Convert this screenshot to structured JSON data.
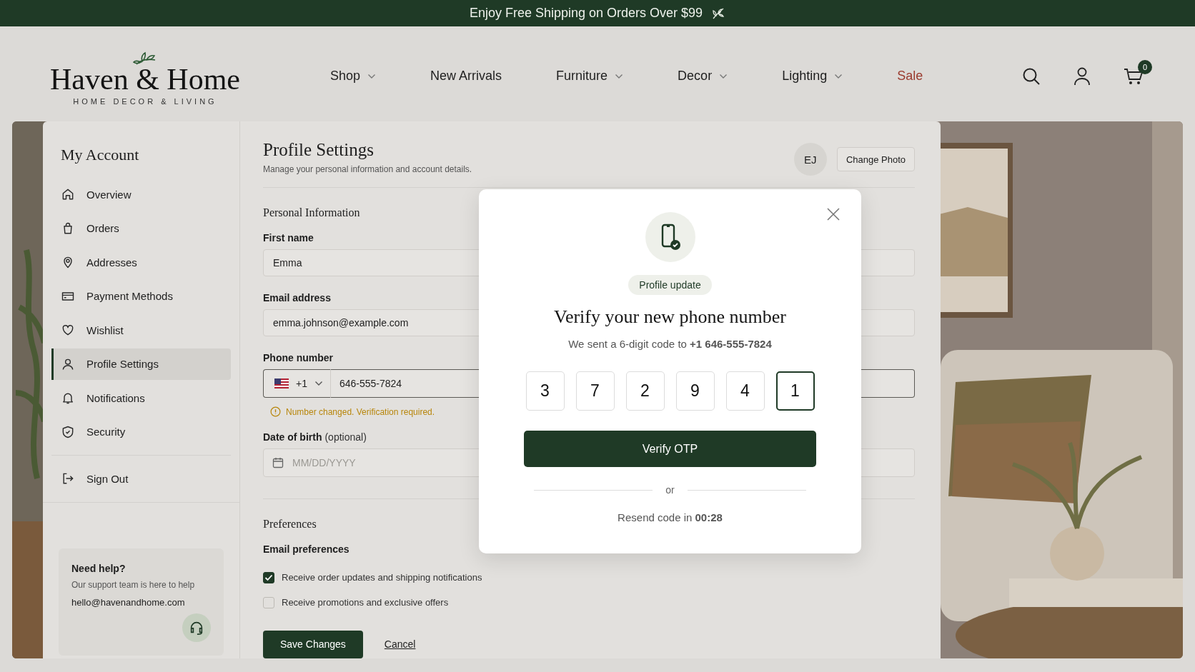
{
  "banner": {
    "text": "Enjoy Free Shipping on Orders Over $99"
  },
  "header": {
    "logo": {
      "name": "Haven & Home",
      "tagline": "HOME DECOR & LIVING"
    },
    "nav": [
      {
        "label": "Shop",
        "has_menu": true,
        "kind": "link"
      },
      {
        "label": "New Arrivals",
        "has_menu": false,
        "kind": "link"
      },
      {
        "label": "Furniture",
        "has_menu": true,
        "kind": "link"
      },
      {
        "label": "Decor",
        "has_menu": true,
        "kind": "link"
      },
      {
        "label": "Lighting",
        "has_menu": true,
        "kind": "link"
      },
      {
        "label": "Sale",
        "has_menu": false,
        "kind": "sale"
      }
    ],
    "cart_count": "0"
  },
  "sidebar": {
    "title": "My Account",
    "items": [
      {
        "label": "Overview",
        "selected": false
      },
      {
        "label": "Orders",
        "selected": false
      },
      {
        "label": "Addresses",
        "selected": false
      },
      {
        "label": "Payment Methods",
        "selected": false
      },
      {
        "label": "Wishlist",
        "selected": false
      },
      {
        "label": "Profile Settings",
        "selected": true
      },
      {
        "label": "Notifications",
        "selected": false
      },
      {
        "label": "Security",
        "selected": false
      }
    ],
    "sign_out": "Sign Out",
    "help": {
      "title": "Need help?",
      "text": "Our support team is here to help",
      "email": "hello@havenandhome.com"
    }
  },
  "profile": {
    "title": "Profile Settings",
    "subtitle": "Manage your personal information and account details.",
    "avatar": "EJ",
    "change_photo": "Change Photo",
    "personal_title": "Personal Information",
    "first_name": {
      "label": "First name",
      "value": "Emma"
    },
    "email": {
      "label": "Email address",
      "value": "emma.johnson@example.com"
    },
    "phone": {
      "label": "Phone number",
      "country_code": "+1",
      "value": "646-555-7824",
      "warning": "Number changed. Verification required."
    },
    "birth": {
      "label": "Date of birth",
      "hint": "(optional)",
      "placeholder": "MM/DD/YYYY"
    },
    "preferences_title": "Preferences",
    "email_prefs_title": "Email preferences",
    "checkboxes": [
      {
        "label": "Receive order updates and shipping notifications",
        "checked": true
      },
      {
        "label": "Receive promotions and exclusive offers",
        "checked": false
      }
    ],
    "save": "Save Changes",
    "cancel": "Cancel"
  },
  "modal": {
    "badge": "Profile update",
    "title": "Verify your new phone number",
    "text": "We sent a 6-digit code to **+1 646-555-7824**",
    "digits": [
      {
        "value": "3",
        "focused": false
      },
      {
        "value": "7",
        "focused": false
      },
      {
        "value": "2",
        "focused": false
      },
      {
        "value": "9",
        "focused": false
      },
      {
        "value": "4",
        "focused": false
      },
      {
        "value": "1",
        "focused": true
      }
    ],
    "verify": "Verify OTP",
    "or": "or",
    "resend": "Resend code in **00:28**"
  }
}
